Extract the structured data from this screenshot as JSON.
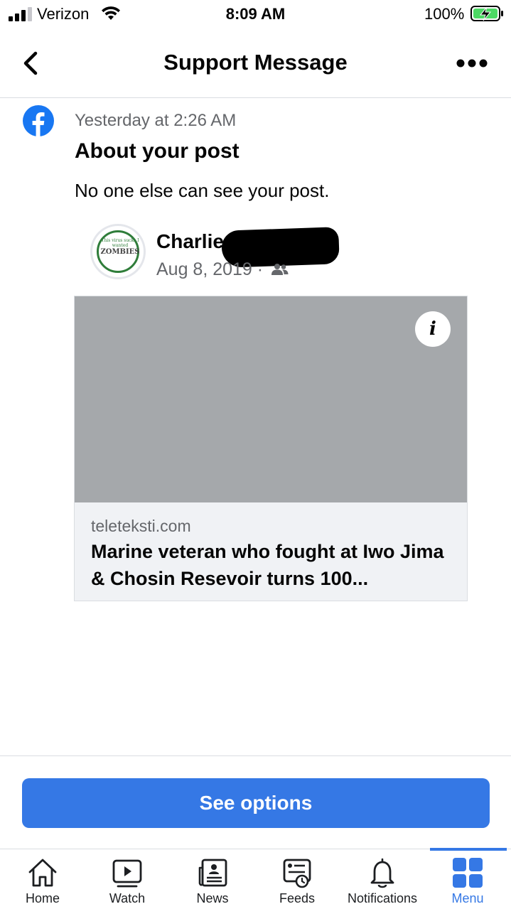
{
  "status_bar": {
    "carrier": "Verizon",
    "time": "8:09 AM",
    "battery": "100%"
  },
  "header": {
    "title": "Support Message"
  },
  "message": {
    "timestamp": "Yesterday at 2:26 AM",
    "title": "About your post",
    "body": "No one else can see your post."
  },
  "post": {
    "author_name": "Charlie",
    "avatar_text_top": "This virus sucks I wanted",
    "avatar_text_main": "ZOMBIES",
    "date": "Aug 8, 2019 ·",
    "audience_icon": "friends-icon"
  },
  "link_card": {
    "info_icon": "i",
    "domain": "teleteksti.com",
    "title": "Marine veteran who fought at Iwo Jima & Chosin Resevoir turns 100..."
  },
  "actions": {
    "primary_label": "See options"
  },
  "tabs": [
    {
      "label": "Home",
      "icon": "home-icon"
    },
    {
      "label": "Watch",
      "icon": "watch-icon"
    },
    {
      "label": "News",
      "icon": "news-icon"
    },
    {
      "label": "Feeds",
      "icon": "feeds-icon"
    },
    {
      "label": "Notifications",
      "icon": "bell-icon"
    },
    {
      "label": "Menu",
      "icon": "menu-grid-icon",
      "active": true
    }
  ],
  "colors": {
    "accent": "#3578e5",
    "secondary_text": "#65676b",
    "battery_green": "#4cd964",
    "image_placeholder": "#a5a8ab"
  }
}
